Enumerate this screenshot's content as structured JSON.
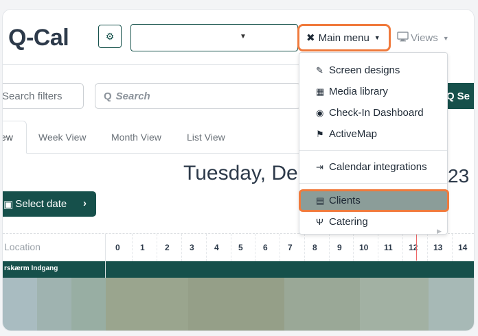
{
  "app": {
    "title": "Q-Cal"
  },
  "header": {
    "main_menu_label": "Main menu",
    "views_label": "Views",
    "department_select_value": ""
  },
  "toolbar": {
    "filters_label": "Search filters",
    "search_placeholder": "Search",
    "search_button_label": "Se"
  },
  "tabs": [
    {
      "label": "ew",
      "active": true
    },
    {
      "label": "Week View",
      "active": false
    },
    {
      "label": "Month View",
      "active": false
    },
    {
      "label": "List View",
      "active": false
    }
  ],
  "calendar": {
    "date_title": "Tuesday, De",
    "date_tail": "23",
    "select_date_label": "Select date",
    "location_header": "Location",
    "hours": [
      "0",
      "1",
      "2",
      "3",
      "4",
      "5",
      "6",
      "7",
      "8",
      "9",
      "10",
      "11",
      "12",
      "13",
      "14"
    ],
    "resource_name": "rskærm Indgang"
  },
  "menu": {
    "items": [
      {
        "label": "Screen designs",
        "icon": "pencil-ruler-icon"
      },
      {
        "label": "Media library",
        "icon": "photo-video-icon"
      },
      {
        "label": "Check-In Dashboard",
        "icon": "tachometer-icon"
      },
      {
        "label": "ActiveMap",
        "icon": "map-marked-icon"
      },
      {
        "label": "Calendar integrations",
        "icon": "file-export-icon"
      },
      {
        "label": "Clients",
        "icon": "address-book-icon"
      },
      {
        "label": "Catering",
        "icon": "utensils-icon"
      }
    ]
  },
  "colors": {
    "accent": "#16504b",
    "highlight": "#f07a3c",
    "selected_row": "#8b9d99"
  }
}
